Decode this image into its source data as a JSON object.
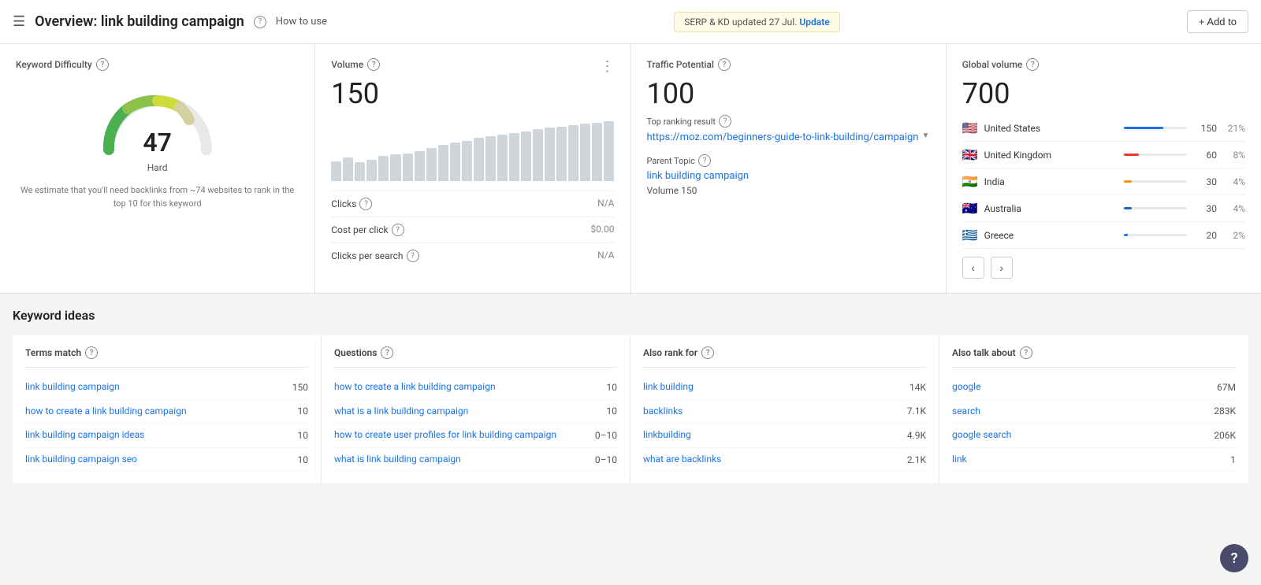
{
  "header": {
    "menu_icon": "☰",
    "title": "Overview: link building campaign",
    "help_icon": "?",
    "how_to_use": "How to use",
    "serp_text": "SERP & KD updated 27 Jul.",
    "serp_update": "Update",
    "add_to": "+ Add to"
  },
  "keyword_difficulty": {
    "label": "Keyword Difficulty",
    "value": "47",
    "sublabel": "Hard",
    "note": "We estimate that you'll need backlinks from ~74 websites to rank in the top 10 for this keyword"
  },
  "volume": {
    "label": "Volume",
    "value": "150",
    "metrics": [
      {
        "label": "Clicks",
        "value": "N/A"
      },
      {
        "label": "Cost per click",
        "value": "$0.00"
      },
      {
        "label": "Clicks per search",
        "value": "N/A"
      }
    ],
    "bars": [
      30,
      35,
      28,
      32,
      38,
      40,
      42,
      45,
      50,
      55,
      58,
      60,
      65,
      68,
      70,
      72,
      75,
      78,
      80,
      82,
      84,
      86,
      88,
      90
    ]
  },
  "traffic_potential": {
    "label": "Traffic Potential",
    "value": "100",
    "top_result_label": "Top ranking result",
    "top_result_url": "https://moz.com/beginners-guide-to-link-building/campaign",
    "parent_topic_label": "Parent Topic",
    "parent_topic_link": "link building campaign",
    "volume_label": "Volume 150"
  },
  "global_volume": {
    "label": "Global volume",
    "value": "700",
    "countries": [
      {
        "name": "United States",
        "flag": "us",
        "vol": "150",
        "pct": "21%",
        "bar": 21,
        "color": "#1a73e8"
      },
      {
        "name": "United Kingdom",
        "flag": "gb",
        "vol": "60",
        "pct": "8%",
        "bar": 8,
        "color": "#e53935"
      },
      {
        "name": "India",
        "flag": "in",
        "vol": "30",
        "pct": "4%",
        "bar": 4,
        "color": "#ff9800"
      },
      {
        "name": "Australia",
        "flag": "au",
        "vol": "30",
        "pct": "4%",
        "bar": 4,
        "color": "#1565c0"
      },
      {
        "name": "Greece",
        "flag": "gr",
        "vol": "20",
        "pct": "2%",
        "bar": 2,
        "color": "#1a73e8"
      }
    ]
  },
  "keyword_ideas": {
    "section_title": "Keyword ideas",
    "columns": [
      {
        "id": "terms_match",
        "header": "Terms match",
        "items": [
          {
            "text": "link building campaign",
            "value": "150"
          },
          {
            "text": "how to create a link building campaign",
            "value": "10"
          },
          {
            "text": "link building campaign ideas",
            "value": "10"
          },
          {
            "text": "link building campaign seo",
            "value": "10"
          }
        ]
      },
      {
        "id": "questions",
        "header": "Questions",
        "items": [
          {
            "text": "how to create a link building campaign",
            "value": "10"
          },
          {
            "text": "what is a link building campaign",
            "value": "10"
          },
          {
            "text": "how to create user profiles for link building campaign",
            "value": "0–10"
          },
          {
            "text": "what is link building campaign",
            "value": "0–10"
          }
        ]
      },
      {
        "id": "also_rank_for",
        "header": "Also rank for",
        "items": [
          {
            "text": "link building",
            "value": "14K"
          },
          {
            "text": "backlinks",
            "value": "7.1K"
          },
          {
            "text": "linkbuilding",
            "value": "4.9K"
          },
          {
            "text": "what are backlinks",
            "value": "2.1K"
          }
        ]
      },
      {
        "id": "also_talk_about",
        "header": "Also talk about",
        "items": [
          {
            "text": "google",
            "value": "67M"
          },
          {
            "text": "search",
            "value": "283K"
          },
          {
            "text": "google search",
            "value": "206K"
          },
          {
            "text": "link",
            "value": "1"
          }
        ]
      }
    ]
  }
}
